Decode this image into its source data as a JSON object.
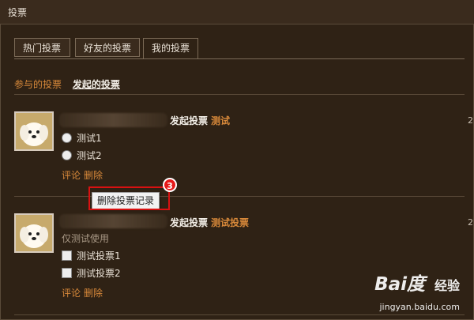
{
  "window": {
    "title": "投票"
  },
  "tabs": [
    {
      "label": "热门投票"
    },
    {
      "label": "好友的投票"
    },
    {
      "label": "我的投票",
      "active": true
    }
  ],
  "subtabs": {
    "participated": "参与的投票",
    "created": "发起的投票"
  },
  "polls": [
    {
      "action_text": "发起投票",
      "title": "测试",
      "option_type": "radio",
      "options": [
        "测试1",
        "测试2"
      ],
      "actions": [
        "评论",
        "删除"
      ]
    },
    {
      "action_text": "发起投票",
      "title": "测试投票",
      "description": "仅测试使用",
      "option_type": "checkbox",
      "options": [
        "测试投票1",
        "测试投票2"
      ],
      "actions": [
        "评论",
        "删除"
      ]
    }
  ],
  "tooltip": {
    "text": "删除投票记录"
  },
  "annotation": {
    "step": "3"
  },
  "sidebar_digits": [
    "2",
    "2"
  ],
  "watermark": {
    "logo": "Bai度",
    "brand": "经验",
    "url": "jingyan.baidu.com"
  },
  "colors": {
    "accent": "#d8893a",
    "background": "#2f2215",
    "highlight": "#d91111"
  }
}
